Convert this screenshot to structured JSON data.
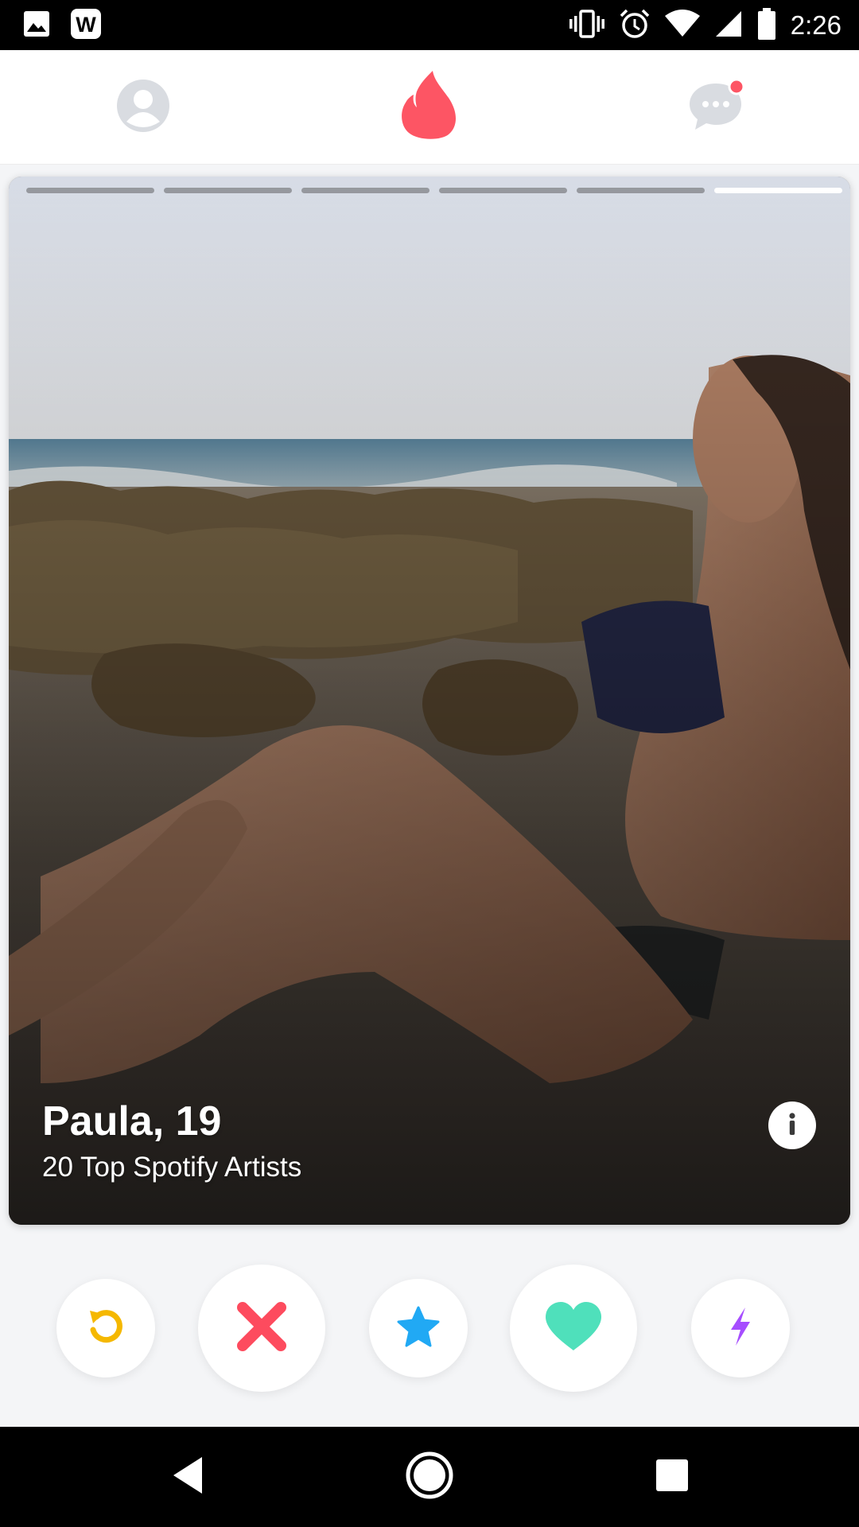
{
  "status_bar": {
    "time": "2:26",
    "icons": [
      "gallery-icon",
      "w-app-icon",
      "vibrate-icon",
      "alarm-icon",
      "wifi-icon",
      "signal-icon",
      "battery-icon"
    ]
  },
  "top_nav": {
    "items": [
      "profile-icon",
      "tinder-flame-icon",
      "messages-icon"
    ],
    "active": "tinder-flame-icon",
    "messages_has_notification": true
  },
  "card": {
    "name_age": "Paula, 19",
    "subtitle": "20 Top Spotify Artists",
    "photo_count": 6,
    "current_photo": 6
  },
  "actions": [
    "rewind-button",
    "nope-button",
    "super-like-button",
    "like-button",
    "boost-button"
  ],
  "colors": {
    "brand": "#fd5564",
    "rewind": "#f5b800",
    "nope": "#fd4b5e",
    "super_like": "#21a9f4",
    "like": "#4fe0bb",
    "boost": "#a64dff"
  },
  "system_nav": [
    "back-icon",
    "home-icon",
    "recents-icon"
  ]
}
